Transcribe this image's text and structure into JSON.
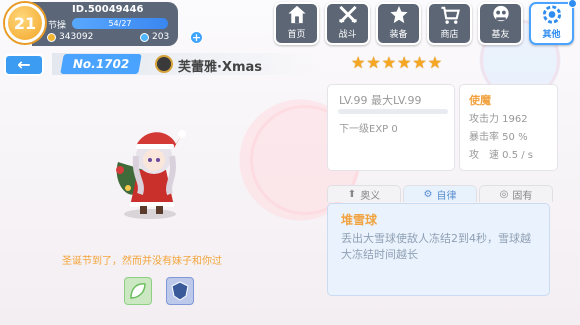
{
  "player": {
    "level": "21",
    "id": "ID.50049446",
    "stamina_label": "节操",
    "stamina_text": "54/27",
    "stamina_fraction": 1.0,
    "coins": "343092",
    "gems": "203"
  },
  "nav": [
    {
      "label": "首页",
      "icon": "home-icon"
    },
    {
      "label": "战斗",
      "icon": "battle-icon"
    },
    {
      "label": "装备",
      "icon": "equipment-icon"
    },
    {
      "label": "商店",
      "icon": "shop-icon"
    },
    {
      "label": "基友",
      "icon": "friends-icon"
    },
    {
      "label": "其他",
      "icon": "settings-icon",
      "active": true
    }
  ],
  "unit": {
    "number": "No.1702",
    "name": "芙蕾雅·Xmas",
    "stars": 6,
    "quote": "圣诞节到了，然而并没有妹子和你过"
  },
  "level_panel": {
    "level_text": "LV.99 最大LV.99",
    "next_exp": "下一级EXP 0"
  },
  "stats": {
    "title": "使魔",
    "attack": "攻击力 1962",
    "crit": "暴击率 50 %",
    "speed": "攻　速 0.5 / s"
  },
  "skill_tabs": [
    {
      "label": "奥义",
      "icon": "arrow-up-icon"
    },
    {
      "label": "自律",
      "icon": "gear-icon",
      "active": true
    },
    {
      "label": "固有",
      "icon": "circle-icon"
    }
  ],
  "skill": {
    "name": "堆雪球",
    "description": "丢出大雪球使敌人冻结2到4秒，雪球越大冻结时间越长"
  },
  "colors": {
    "accent": "#4aa4ff",
    "star": "#f5a623",
    "orange_text": "#f1a341"
  }
}
